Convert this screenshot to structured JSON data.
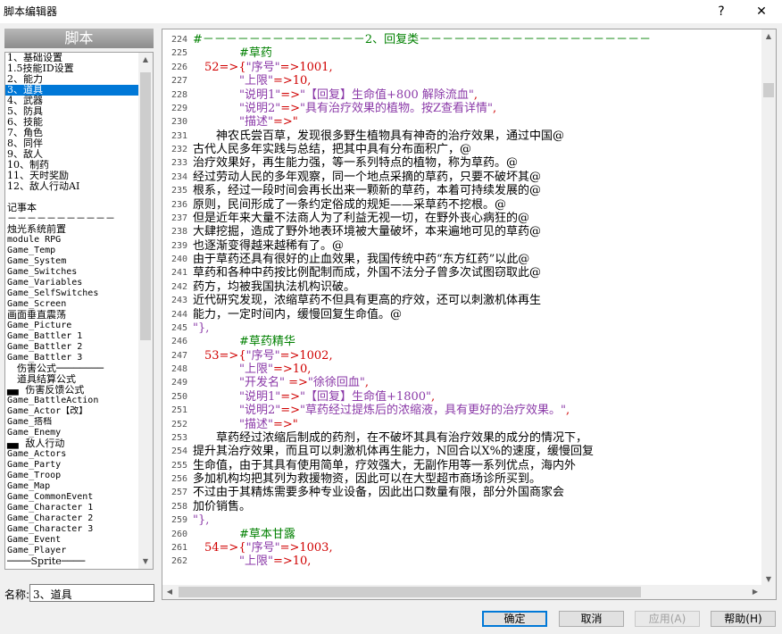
{
  "window": {
    "title": "脚本编辑器",
    "help_glyph": "?",
    "close_glyph": "✕"
  },
  "left_panel": {
    "header": "脚本",
    "items": [
      {
        "label": "1、基础设置",
        "mono": false,
        "selected": false
      },
      {
        "label": "1.5技能ID设置",
        "mono": false,
        "selected": false
      },
      {
        "label": "2、能力",
        "mono": false,
        "selected": false
      },
      {
        "label": "3、道具",
        "mono": false,
        "selected": true
      },
      {
        "label": "4、武器",
        "mono": false,
        "selected": false
      },
      {
        "label": "5、防具",
        "mono": false,
        "selected": false
      },
      {
        "label": "6、技能",
        "mono": false,
        "selected": false
      },
      {
        "label": "7、角色",
        "mono": false,
        "selected": false
      },
      {
        "label": "8、同伴",
        "mono": false,
        "selected": false
      },
      {
        "label": "9、敌人",
        "mono": false,
        "selected": false
      },
      {
        "label": "10、制药",
        "mono": false,
        "selected": false
      },
      {
        "label": "11、天时奖励",
        "mono": false,
        "selected": false
      },
      {
        "label": "12、敌人行动AI",
        "mono": false,
        "selected": false
      },
      {
        "label": "",
        "mono": false,
        "selected": false
      },
      {
        "label": "记事本",
        "mono": false,
        "selected": false
      },
      {
        "label": "－－－－－－－－－－－",
        "mono": false,
        "selected": false
      },
      {
        "label": "烛光系统前置",
        "mono": false,
        "selected": false
      },
      {
        "label": "module RPG",
        "mono": true,
        "selected": false
      },
      {
        "label": "Game_Temp",
        "mono": true,
        "selected": false
      },
      {
        "label": "Game_System",
        "mono": true,
        "selected": false
      },
      {
        "label": "Game_Switches",
        "mono": true,
        "selected": false
      },
      {
        "label": "Game_Variables",
        "mono": true,
        "selected": false
      },
      {
        "label": "Game_SelfSwitches",
        "mono": true,
        "selected": false
      },
      {
        "label": "Game_Screen",
        "mono": true,
        "selected": false
      },
      {
        "label": "画面垂直震荡",
        "mono": false,
        "selected": false
      },
      {
        "label": "Game_Picture",
        "mono": true,
        "selected": false
      },
      {
        "label": "Game_Battler 1",
        "mono": true,
        "selected": false
      },
      {
        "label": "Game_Battler 2",
        "mono": true,
        "selected": false
      },
      {
        "label": "Game_Battler 3",
        "mono": true,
        "selected": false
      },
      {
        "label": "　伤害公式────────",
        "mono": false,
        "selected": false
      },
      {
        "label": "　道具结算公式",
        "mono": false,
        "selected": false
      },
      {
        "label": "▄▖ 伤害反馈公式",
        "mono": false,
        "selected": false
      },
      {
        "label": "Game_BattleAction",
        "mono": true,
        "selected": false
      },
      {
        "label": "Game_Actor【改】",
        "mono": true,
        "selected": false
      },
      {
        "label": "Game_搭档",
        "mono": true,
        "selected": false
      },
      {
        "label": "Game_Enemy",
        "mono": true,
        "selected": false
      },
      {
        "label": "▄▖ 敌人行动",
        "mono": false,
        "selected": false
      },
      {
        "label": "Game_Actors",
        "mono": true,
        "selected": false
      },
      {
        "label": "Game_Party",
        "mono": true,
        "selected": false
      },
      {
        "label": "Game_Troop",
        "mono": true,
        "selected": false
      },
      {
        "label": "Game_Map",
        "mono": true,
        "selected": false
      },
      {
        "label": "Game_CommonEvent",
        "mono": true,
        "selected": false
      },
      {
        "label": "Game_Character 1",
        "mono": true,
        "selected": false
      },
      {
        "label": "Game_Character 2",
        "mono": true,
        "selected": false
      },
      {
        "label": "Game_Character 3",
        "mono": true,
        "selected": false
      },
      {
        "label": "Game_Event",
        "mono": true,
        "selected": false
      },
      {
        "label": "Game_Player",
        "mono": true,
        "selected": false
      },
      {
        "label": "────Sprite────",
        "mono": false,
        "selected": false
      }
    ],
    "name_label": "名称:",
    "name_value": "3、道具"
  },
  "editor": {
    "lines": [
      {
        "n": "224",
        "parts": [
          {
            "t": "#－－－－－－－－－－－－－－2、回复类－－－－－－－－－－－－－－－－－－－－",
            "c": "comment"
          }
        ]
      },
      {
        "n": "225",
        "parts": [
          {
            "t": "　　　　#草药",
            "c": "comment"
          }
        ]
      },
      {
        "n": "226",
        "parts": [
          {
            "t": "　52=>{",
            "c": "red"
          },
          {
            "t": "\"序号\"",
            "c": "purple"
          },
          {
            "t": "=>1001,",
            "c": "red"
          }
        ]
      },
      {
        "n": "227",
        "parts": [
          {
            "t": "　　　　",
            "c": "red"
          },
          {
            "t": "\"上限\"",
            "c": "purple"
          },
          {
            "t": "=>10,",
            "c": "red"
          }
        ]
      },
      {
        "n": "228",
        "parts": [
          {
            "t": "　　　　",
            "c": "red"
          },
          {
            "t": "\"说明1\"",
            "c": "purple"
          },
          {
            "t": "=>",
            "c": "red"
          },
          {
            "t": "\"【回复】生命值+800 解除流血\"",
            "c": "purple"
          },
          {
            "t": ",",
            "c": "red"
          }
        ]
      },
      {
        "n": "229",
        "parts": [
          {
            "t": "　　　　",
            "c": "red"
          },
          {
            "t": "\"说明2\"",
            "c": "purple"
          },
          {
            "t": "=>",
            "c": "red"
          },
          {
            "t": "\"具有治疗效果的植物。按Z查看详情\"",
            "c": "purple"
          },
          {
            "t": ",",
            "c": "red"
          }
        ]
      },
      {
        "n": "230",
        "parts": [
          {
            "t": "　　　　",
            "c": "red"
          },
          {
            "t": "\"描述\"",
            "c": "purple"
          },
          {
            "t": "=>\"",
            "c": "red"
          }
        ]
      },
      {
        "n": "231",
        "parts": [
          {
            "t": "　　神农氏尝百草，发现很多野生植物具有神奇的治疗效果，通过中国@",
            "c": "black"
          }
        ]
      },
      {
        "n": "232",
        "parts": [
          {
            "t": "古代人民多年实践与总结，把其中具有分布面积广，@",
            "c": "black"
          }
        ]
      },
      {
        "n": "233",
        "parts": [
          {
            "t": "治疗效果好，再生能力强，等一系列特点的植物，称为草药。@",
            "c": "black"
          }
        ]
      },
      {
        "n": "234",
        "parts": [
          {
            "t": "经过劳动人民的多年观察，同一个地点采摘的草药，只要不破坏其@",
            "c": "black"
          }
        ]
      },
      {
        "n": "235",
        "parts": [
          {
            "t": "根系，经过一段时间会再长出来一颗新的草药，本着可持续发展的@",
            "c": "black"
          }
        ]
      },
      {
        "n": "236",
        "parts": [
          {
            "t": "原则，民间形成了一条约定俗成的规矩——采草药不挖根。@",
            "c": "black"
          }
        ]
      },
      {
        "n": "237",
        "parts": [
          {
            "t": "但是近年来大量不法商人为了利益无视一切，在野外丧心病狂的@",
            "c": "black"
          }
        ]
      },
      {
        "n": "238",
        "parts": [
          {
            "t": "大肆挖掘，造成了野外地表环境被大量破坏，本来遍地可见的草药@",
            "c": "black"
          }
        ]
      },
      {
        "n": "239",
        "parts": [
          {
            "t": "也逐渐变得越来越稀有了。@",
            "c": "black"
          }
        ]
      },
      {
        "n": "240",
        "parts": [
          {
            "t": "由于草药还具有很好的止血效果，我国传统中药“东方红药”以此@",
            "c": "black"
          }
        ]
      },
      {
        "n": "241",
        "parts": [
          {
            "t": "草药和各种中药按比例配制而成，外国不法分子曾多次试图窃取此@",
            "c": "black"
          }
        ]
      },
      {
        "n": "242",
        "parts": [
          {
            "t": "药方，均被我国执法机构识破。",
            "c": "black"
          }
        ]
      },
      {
        "n": "243",
        "parts": [
          {
            "t": "近代研究发现，浓缩草药不但具有更高的疗效，还可以刺激机体再生",
            "c": "black"
          }
        ]
      },
      {
        "n": "244",
        "parts": [
          {
            "t": "能力，一定时间内，缓慢回复生命值。@",
            "c": "black"
          }
        ]
      },
      {
        "n": "245",
        "parts": [
          {
            "t": "\"},",
            "c": "purple"
          }
        ]
      },
      {
        "n": "246",
        "parts": [
          {
            "t": "　　　　#草药精华",
            "c": "comment"
          }
        ]
      },
      {
        "n": "247",
        "parts": [
          {
            "t": "　53=>{",
            "c": "red"
          },
          {
            "t": "\"序号\"",
            "c": "purple"
          },
          {
            "t": "=>1002,",
            "c": "red"
          }
        ]
      },
      {
        "n": "248",
        "parts": [
          {
            "t": "　　　　",
            "c": "red"
          },
          {
            "t": "\"上限\"",
            "c": "purple"
          },
          {
            "t": "=>10,",
            "c": "red"
          }
        ]
      },
      {
        "n": "249",
        "parts": [
          {
            "t": "　　　　",
            "c": "red"
          },
          {
            "t": "\"开发名\"",
            "c": "purple"
          },
          {
            "t": " =>",
            "c": "red"
          },
          {
            "t": "\"徐徐回血\"",
            "c": "purple"
          },
          {
            "t": ",",
            "c": "red"
          }
        ]
      },
      {
        "n": "250",
        "parts": [
          {
            "t": "　　　　",
            "c": "red"
          },
          {
            "t": "\"说明1\"",
            "c": "purple"
          },
          {
            "t": "=>",
            "c": "red"
          },
          {
            "t": "\"【回复】生命值+1800\"",
            "c": "purple"
          },
          {
            "t": ",",
            "c": "red"
          }
        ]
      },
      {
        "n": "251",
        "parts": [
          {
            "t": "　　　　",
            "c": "red"
          },
          {
            "t": "\"说明2\"",
            "c": "purple"
          },
          {
            "t": "=>",
            "c": "red"
          },
          {
            "t": "\"草药经过提炼后的浓缩液，具有更好的治疗效果。\"",
            "c": "purple"
          },
          {
            "t": ",",
            "c": "red"
          }
        ]
      },
      {
        "n": "252",
        "parts": [
          {
            "t": "　　　　",
            "c": "red"
          },
          {
            "t": "\"描述\"",
            "c": "purple"
          },
          {
            "t": "=>\"",
            "c": "red"
          }
        ]
      },
      {
        "n": "253",
        "parts": [
          {
            "t": "　　草药经过浓缩后制成的药剂，在不破坏其具有治疗效果的成分的情况下，",
            "c": "black"
          }
        ]
      },
      {
        "n": "254",
        "parts": [
          {
            "t": "提升其治疗效果，而且可以刺激机体再生能力，N回合以X%的速度，缓慢回复",
            "c": "black"
          }
        ]
      },
      {
        "n": "255",
        "parts": [
          {
            "t": "生命值，由于其具有使用简单，疗效强大，无副作用等一系列优点，海内外",
            "c": "black"
          }
        ]
      },
      {
        "n": "256",
        "parts": [
          {
            "t": "多加机构均把其列为救援物资，因此可以在大型超市商场诊所买到。",
            "c": "black"
          }
        ]
      },
      {
        "n": "257",
        "parts": [
          {
            "t": "不过由于其精炼需要多种专业设备，因此出口数量有限，部分外国商家会",
            "c": "black"
          }
        ]
      },
      {
        "n": "258",
        "parts": [
          {
            "t": "加价销售。",
            "c": "black"
          }
        ]
      },
      {
        "n": "259",
        "parts": [
          {
            "t": "\"},",
            "c": "purple"
          }
        ]
      },
      {
        "n": "260",
        "parts": [
          {
            "t": "　　　　#草本甘露",
            "c": "comment"
          }
        ]
      },
      {
        "n": "261",
        "parts": [
          {
            "t": "　54=>{",
            "c": "red"
          },
          {
            "t": "\"序号\"",
            "c": "purple"
          },
          {
            "t": "=>1003,",
            "c": "red"
          }
        ]
      },
      {
        "n": "262",
        "parts": [
          {
            "t": "　　　　",
            "c": "red"
          },
          {
            "t": "\"上限\"",
            "c": "purple"
          },
          {
            "t": "=>10,",
            "c": "red"
          }
        ]
      }
    ]
  },
  "buttons": {
    "ok": "确定",
    "cancel": "取消",
    "apply": "应用(A)",
    "help": "帮助(H)"
  },
  "colors": {
    "comment": "#008000",
    "keyword": "#d00000",
    "string": "#8b3aa8",
    "selection": "#0078d7"
  }
}
